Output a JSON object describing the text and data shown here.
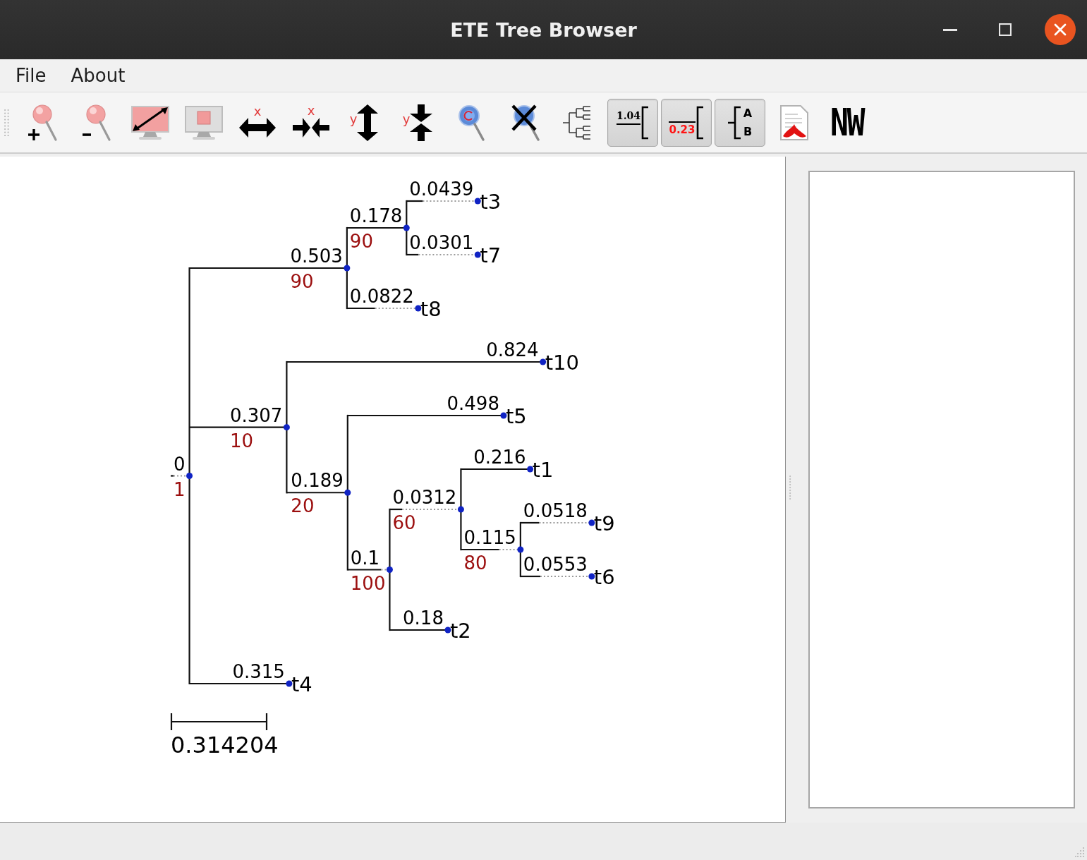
{
  "window": {
    "title": "ETE Tree Browser"
  },
  "menu": [
    "File",
    "About"
  ],
  "toolbar": [
    {
      "kind": "zoomin",
      "checked": false
    },
    {
      "kind": "zoomout",
      "checked": false
    },
    {
      "kind": "fit",
      "checked": false
    },
    {
      "kind": "fitsel",
      "checked": false
    },
    {
      "kind": "xwide",
      "label": "x",
      "checked": false
    },
    {
      "kind": "xnarrow",
      "label": "x",
      "checked": false
    },
    {
      "kind": "ytall",
      "label": "y",
      "checked": false
    },
    {
      "kind": "yshort",
      "label": "y",
      "checked": false
    },
    {
      "kind": "search",
      "checked": false
    },
    {
      "kind": "clearsearch",
      "checked": false
    },
    {
      "kind": "tree",
      "checked": false
    },
    {
      "kind": "branchlength",
      "label": "1.04",
      "checked": true
    },
    {
      "kind": "support",
      "label": "0.23",
      "checked": true
    },
    {
      "kind": "leafnames",
      "labels": [
        "A",
        "B"
      ],
      "checked": true
    },
    {
      "kind": "pdf",
      "checked": false
    },
    {
      "kind": "newick",
      "label": "NW",
      "checked": false
    }
  ],
  "tree": {
    "root": {
      "branch_length": "0",
      "support": "1",
      "children": [
        {
          "branch_length": "0.503",
          "support": "90",
          "children": [
            {
              "branch_length": "0.178",
              "support": "90",
              "children": [
                {
                  "branch_length": "0.0439",
                  "name": "t3"
                },
                {
                  "branch_length": "0.0301",
                  "name": "t7"
                }
              ]
            },
            {
              "branch_length": "0.0822",
              "name": "t8"
            }
          ]
        },
        {
          "branch_length": "0.307",
          "support": "10",
          "children": [
            {
              "branch_length": "0.824",
              "name": "t10"
            },
            {
              "branch_length": "0.189",
              "support": "20",
              "children": [
                {
                  "branch_length": "0.498",
                  "name": "t5"
                },
                {
                  "branch_length": "0.1",
                  "support": "100",
                  "children": [
                    {
                      "branch_length": "0.0312",
                      "support": "60",
                      "children": [
                        {
                          "branch_length": "0.216",
                          "name": "t1"
                        },
                        {
                          "branch_length": "0.115",
                          "support": "80",
                          "children": [
                            {
                              "branch_length": "0.0518",
                              "name": "t9"
                            },
                            {
                              "branch_length": "0.0553",
                              "name": "t6"
                            }
                          ]
                        }
                      ]
                    },
                    {
                      "branch_length": "0.18",
                      "name": "t2"
                    }
                  ]
                }
              ]
            }
          ]
        },
        {
          "branch_length": "0.315",
          "name": "t4"
        }
      ]
    },
    "scale_label": "0.314204"
  }
}
